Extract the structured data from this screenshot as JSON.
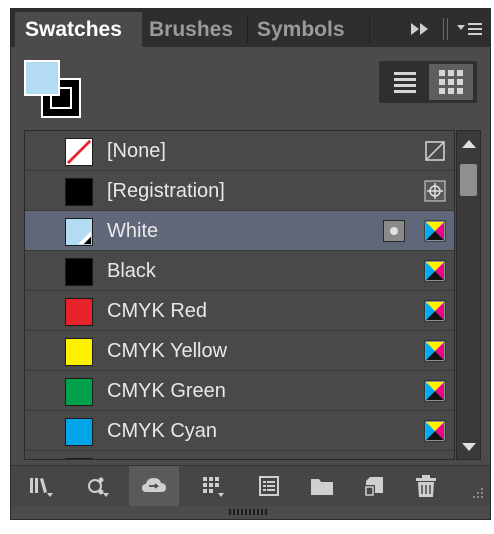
{
  "tabs": [
    {
      "label": "Swatches",
      "active": true
    },
    {
      "label": "Brushes",
      "active": false
    },
    {
      "label": "Symbols",
      "active": false
    }
  ],
  "tabbar_icons": [
    "expand-panel-icon",
    "panel-menu-icon"
  ],
  "fill_stroke": {
    "fill_color": "#b3dbf2",
    "stroke_color": "#000000"
  },
  "view_toggle": {
    "list_icon": "list-view-icon",
    "grid_icon": "thumbnail-view-icon",
    "active": "grid"
  },
  "swatches": [
    {
      "name": "[None]",
      "color": "none",
      "type_icon": "none-icon"
    },
    {
      "name": "[Registration]",
      "color": "#000000",
      "type_icon": "registration-icon"
    },
    {
      "name": "White",
      "color": "#b3dbf2",
      "type_icon": "process-color-icon",
      "selected": true,
      "spot_icon": true
    },
    {
      "name": "Black",
      "color": "#000000",
      "type_icon": "process-color-icon"
    },
    {
      "name": "CMYK Red",
      "color": "#e8232b",
      "type_icon": "process-color-icon"
    },
    {
      "name": "CMYK Yellow",
      "color": "#fff200",
      "type_icon": "process-color-icon"
    },
    {
      "name": "CMYK Green",
      "color": "#00a14b",
      "type_icon": "process-color-icon"
    },
    {
      "name": "CMYK Cyan",
      "color": "#00a5e8",
      "type_icon": "process-color-icon"
    },
    {
      "name": "",
      "color": "#2e3192",
      "type_icon": "process-color-icon"
    }
  ],
  "bottom_icons": [
    "swatch-libraries-icon",
    "show-swatch-kinds-icon",
    "cloud-sync-icon",
    "swatch-options-icon",
    "new-color-group-icon",
    "folder-icon",
    "new-swatch-icon",
    "trash-icon"
  ],
  "colors": {
    "panel_bg": "#4b4b4b",
    "tabbar_bg": "#2e2e2e",
    "selected_row": "#5f6779",
    "text": "#e8e8e8"
  }
}
